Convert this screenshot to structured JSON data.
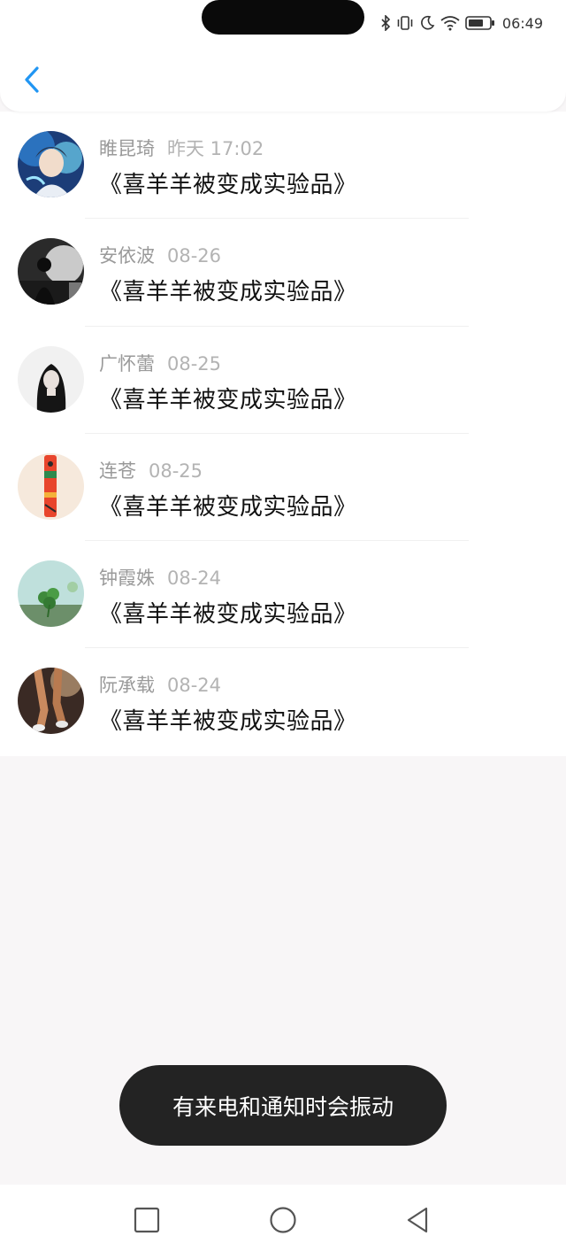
{
  "status_bar": {
    "time": "06:49",
    "icons": [
      "bluetooth-icon",
      "vibrate-icon",
      "moon-icon",
      "wifi-icon",
      "battery-icon"
    ]
  },
  "header": {
    "back_icon": "chevron-left-icon",
    "accent": "#2196f3"
  },
  "list": [
    {
      "name": "睢昆琦",
      "time": "昨天 17:02",
      "title": "《喜羊羊被变成实验品》",
      "avatar": "anime-avatar"
    },
    {
      "name": "安依波",
      "time": "08-26",
      "title": "《喜羊羊被变成实验品》",
      "avatar": "bw-city-avatar"
    },
    {
      "name": "广怀蕾",
      "time": "08-25",
      "title": "《喜羊羊被变成实验品》",
      "avatar": "girl-sketch-avatar"
    },
    {
      "name": "连苍",
      "time": "08-25",
      "title": "《喜羊羊被变成实验品》",
      "avatar": "totem-avatar"
    },
    {
      "name": "钟霞姝",
      "time": "08-24",
      "title": "《喜羊羊被变成实验品》",
      "avatar": "clover-avatar"
    },
    {
      "name": "阮承载",
      "time": "08-24",
      "title": "《喜羊羊被变成实验品》",
      "avatar": "runner-avatar"
    }
  ],
  "toast": {
    "text": "有来电和通知时会振动"
  },
  "nav_bar": {
    "buttons": [
      "recents-square-icon",
      "home-circle-icon",
      "back-triangle-icon"
    ]
  }
}
